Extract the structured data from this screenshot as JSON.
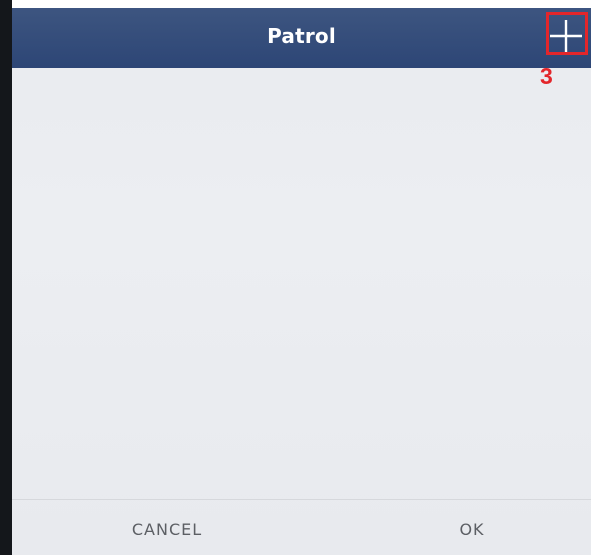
{
  "header": {
    "title": "Patrol",
    "add_icon": "plus-icon"
  },
  "annotation": {
    "step_number": "3",
    "highlight_color": "#e3262b"
  },
  "footer": {
    "cancel_label": "CANCEL",
    "ok_label": "OK"
  },
  "colors": {
    "header_bg": "#2d4676",
    "body_bg": "#eceef2",
    "footer_text": "#5c5f64"
  }
}
